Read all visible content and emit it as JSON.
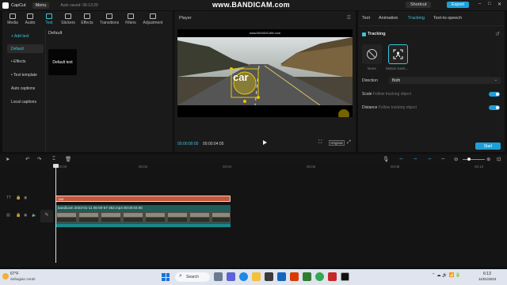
{
  "titlebar": {
    "app_name": "CapCut",
    "menu_label": "Menu",
    "autosave": "Auto saved: 06:13:20",
    "watermark": "www.BANDICAM.com",
    "shortcut_label": "Shortcut",
    "export_label": "Export"
  },
  "toolbar": {
    "tabs": [
      {
        "label": "Media",
        "icon": "media-icon"
      },
      {
        "label": "Audio",
        "icon": "audio-icon"
      },
      {
        "label": "Text",
        "icon": "text-icon"
      },
      {
        "label": "Stickers",
        "icon": "sticker-icon"
      },
      {
        "label": "Effects",
        "icon": "effects-icon"
      },
      {
        "label": "Transitions",
        "icon": "transitions-icon"
      },
      {
        "label": "Filters",
        "icon": "filters-icon"
      },
      {
        "label": "Adjustment",
        "icon": "adjustment-icon"
      }
    ],
    "active_tab": "Text"
  },
  "text_sidebar": {
    "items": [
      "+ Add text",
      "Default",
      "• Effects",
      "• Text template",
      "Auto captions",
      "Local captions"
    ],
    "active_item": "Default"
  },
  "text_content": {
    "heading": "Default",
    "card_label": "Default text"
  },
  "player": {
    "title": "Player",
    "overlay_text": "car",
    "video_watermark": "www.BANDICAM.com",
    "current_time": "00:00:00:00",
    "total_time": "00:00:04:05",
    "ratio_label": "Original"
  },
  "right_panel": {
    "tabs": [
      "Text",
      "Animation",
      "Tracking",
      "Text-to-speech"
    ],
    "active_tab": "Tracking",
    "section_title": "Tracking",
    "options": [
      {
        "label": "None",
        "icon": "none-icon"
      },
      {
        "label": "Motion track...",
        "icon": "motion-track-icon"
      }
    ],
    "selected_option": "Motion track...",
    "direction_label": "Direction",
    "direction_value": "Both",
    "scale_label": "Scale",
    "scale_hint": "Follow tracking object",
    "distance_label": "Distance",
    "distance_hint": "Follow tracking object",
    "start_label": "Start",
    "accent_color": "#1e9fd8"
  },
  "timeline": {
    "ruler_labels": [
      "00:00",
      "00:02",
      "00:04",
      "00:06",
      "00:08",
      "00:10"
    ],
    "text_clip_label": "car",
    "video_clip_label": "bandicam 2023-01-11 06-00-57-352.mp4   00:00:04:05"
  },
  "taskbar": {
    "temperature": "67°F",
    "weather_desc": "Sebagian cerah",
    "search_label": "Search",
    "time": "6:13",
    "date": "11/01/2023"
  }
}
